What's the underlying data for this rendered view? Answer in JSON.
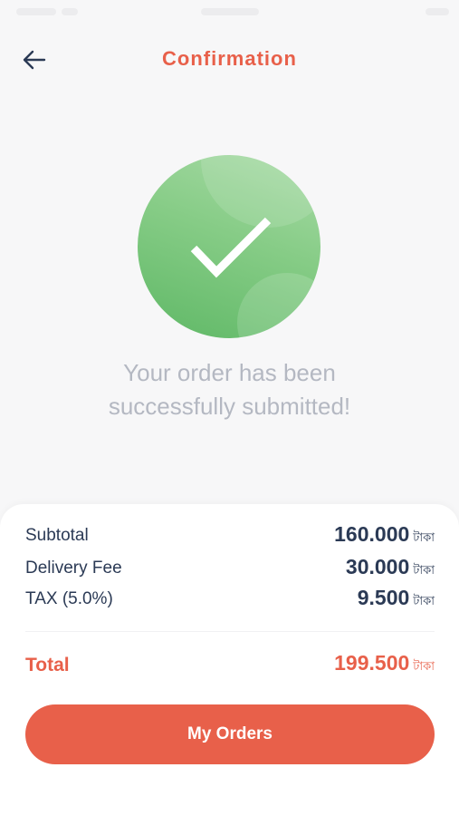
{
  "header": {
    "title": "Confirmation",
    "back_icon": "arrow-left-icon"
  },
  "success": {
    "icon": "checkmark-icon",
    "message_line1": "Your order has been",
    "message_line2": "successfully submitted!"
  },
  "summary": {
    "rows": [
      {
        "label": "Subtotal",
        "value": "160.000",
        "currency": "টাকা"
      },
      {
        "label": "Delivery Fee",
        "value": "30.000",
        "currency": "টাকা"
      },
      {
        "label": "TAX (5.0%)",
        "value": "9.500",
        "currency": "টাকা"
      }
    ],
    "total": {
      "label": "Total",
      "value": "199.500",
      "currency": "টাকা"
    }
  },
  "actions": {
    "my_orders_label": "My Orders"
  },
  "colors": {
    "accent": "#e8604a",
    "text_dark": "#2b3a55",
    "success_green": "#6fc072",
    "muted_text": "#b4b8c2"
  }
}
